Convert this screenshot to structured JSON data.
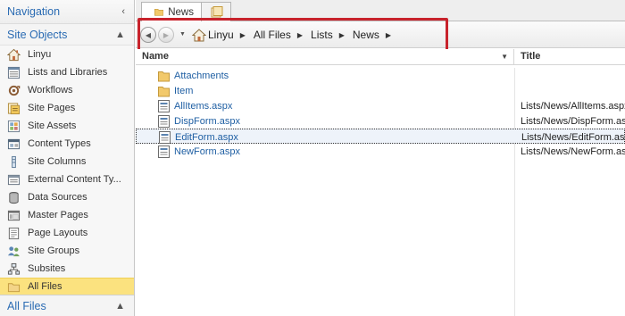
{
  "nav": {
    "header_label": "Navigation",
    "header_glyph": "‹",
    "section_label": "Site Objects",
    "section_glyph": "▲",
    "items": [
      {
        "label": "Linyu",
        "icon": "home-icon"
      },
      {
        "label": "Lists and Libraries",
        "icon": "list-icon"
      },
      {
        "label": "Workflows",
        "icon": "workflow-icon"
      },
      {
        "label": "Site Pages",
        "icon": "page-icon"
      },
      {
        "label": "Site Assets",
        "icon": "assets-icon"
      },
      {
        "label": "Content Types",
        "icon": "content-types-icon"
      },
      {
        "label": "Site Columns",
        "icon": "column-icon"
      },
      {
        "label": "External Content Ty...",
        "icon": "external-content-icon"
      },
      {
        "label": "Data Sources",
        "icon": "database-icon"
      },
      {
        "label": "Master Pages",
        "icon": "master-page-icon"
      },
      {
        "label": "Page Layouts",
        "icon": "layout-icon"
      },
      {
        "label": "Site Groups",
        "icon": "group-icon"
      },
      {
        "label": "Subsites",
        "icon": "subsites-icon"
      },
      {
        "label": "All Files",
        "icon": "folder-icon"
      }
    ],
    "footer_label": "All Files",
    "footer_glyph": "▲"
  },
  "tabs": {
    "active_label": "News"
  },
  "address": {
    "back_glyph": "◀",
    "forward_glyph": "▶",
    "history_glyph": "▼",
    "separator": "▶",
    "crumbs": [
      "Linyu",
      "All Files",
      "Lists",
      "News"
    ]
  },
  "columns": {
    "name": "Name",
    "sort_glyph": "▼",
    "title": "Title"
  },
  "files": [
    {
      "name": "Attachments",
      "title": "",
      "type": "folder"
    },
    {
      "name": "Item",
      "title": "",
      "type": "folder"
    },
    {
      "name": "AllItems.aspx",
      "title": "Lists/News/AllItems.aspx",
      "type": "aspx"
    },
    {
      "name": "DispForm.aspx",
      "title": "Lists/News/DispForm.aspx",
      "type": "aspx"
    },
    {
      "name": "EditForm.aspx",
      "title": "Lists/News/EditForm.aspx",
      "type": "aspx",
      "selected": true
    },
    {
      "name": "NewForm.aspx",
      "title": "Lists/News/NewForm.aspx",
      "type": "aspx"
    }
  ],
  "colors": {
    "accent": "#2a6bb3",
    "selected_nav": "#fbe27f",
    "highlight_box": "#c8232c"
  }
}
